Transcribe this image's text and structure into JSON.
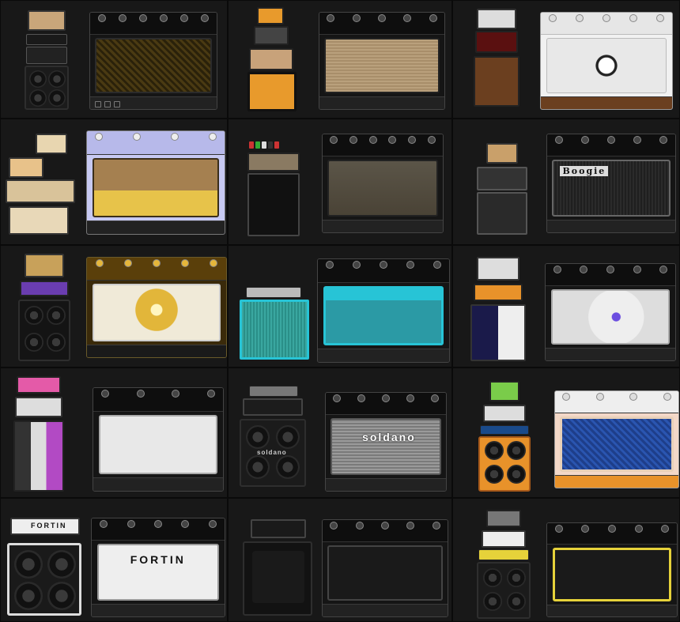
{
  "collage": {
    "cells": [
      {
        "id": "r1c1",
        "brand": ""
      },
      {
        "id": "r1c2",
        "brand": ""
      },
      {
        "id": "r1c3",
        "brand": ""
      },
      {
        "id": "r2c1",
        "brand": ""
      },
      {
        "id": "r2c2",
        "brand": ""
      },
      {
        "id": "r2c3",
        "brand": "Boogie"
      },
      {
        "id": "r3c1",
        "brand": ""
      },
      {
        "id": "r3c2",
        "brand": ""
      },
      {
        "id": "r3c3",
        "brand": ""
      },
      {
        "id": "r4c1",
        "brand": ""
      },
      {
        "id": "r4c2",
        "brand": "soldano",
        "cab_brand": "soldano"
      },
      {
        "id": "r4c3",
        "brand": ""
      },
      {
        "id": "r5c1",
        "brand": "FORTIN",
        "mini_brand": "FORTIN"
      },
      {
        "id": "r5c2",
        "brand": ""
      },
      {
        "id": "r5c3",
        "brand": ""
      }
    ]
  },
  "colors": {
    "bg": "#111111",
    "accent_red": "#d33b2a",
    "soldano_grey": "#8a8a8a",
    "cyan": "#27c4d6",
    "yellow": "#e6d23a",
    "orange": "#e8922a"
  },
  "icons": [
    "knob-icon",
    "speaker-icon",
    "pedal-icon",
    "preset-switch-icon"
  ]
}
